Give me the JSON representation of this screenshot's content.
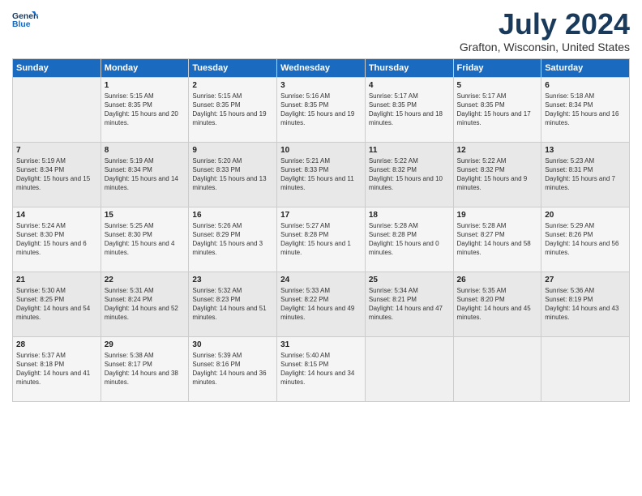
{
  "header": {
    "logo_line1": "General",
    "logo_line2": "Blue",
    "month": "July 2024",
    "location": "Grafton, Wisconsin, United States"
  },
  "weekdays": [
    "Sunday",
    "Monday",
    "Tuesday",
    "Wednesday",
    "Thursday",
    "Friday",
    "Saturday"
  ],
  "weeks": [
    [
      {
        "day": "",
        "sunrise": "",
        "sunset": "",
        "daylight": ""
      },
      {
        "day": "1",
        "sunrise": "Sunrise: 5:15 AM",
        "sunset": "Sunset: 8:35 PM",
        "daylight": "Daylight: 15 hours and 20 minutes."
      },
      {
        "day": "2",
        "sunrise": "Sunrise: 5:15 AM",
        "sunset": "Sunset: 8:35 PM",
        "daylight": "Daylight: 15 hours and 19 minutes."
      },
      {
        "day": "3",
        "sunrise": "Sunrise: 5:16 AM",
        "sunset": "Sunset: 8:35 PM",
        "daylight": "Daylight: 15 hours and 19 minutes."
      },
      {
        "day": "4",
        "sunrise": "Sunrise: 5:17 AM",
        "sunset": "Sunset: 8:35 PM",
        "daylight": "Daylight: 15 hours and 18 minutes."
      },
      {
        "day": "5",
        "sunrise": "Sunrise: 5:17 AM",
        "sunset": "Sunset: 8:35 PM",
        "daylight": "Daylight: 15 hours and 17 minutes."
      },
      {
        "day": "6",
        "sunrise": "Sunrise: 5:18 AM",
        "sunset": "Sunset: 8:34 PM",
        "daylight": "Daylight: 15 hours and 16 minutes."
      }
    ],
    [
      {
        "day": "7",
        "sunrise": "Sunrise: 5:19 AM",
        "sunset": "Sunset: 8:34 PM",
        "daylight": "Daylight: 15 hours and 15 minutes."
      },
      {
        "day": "8",
        "sunrise": "Sunrise: 5:19 AM",
        "sunset": "Sunset: 8:34 PM",
        "daylight": "Daylight: 15 hours and 14 minutes."
      },
      {
        "day": "9",
        "sunrise": "Sunrise: 5:20 AM",
        "sunset": "Sunset: 8:33 PM",
        "daylight": "Daylight: 15 hours and 13 minutes."
      },
      {
        "day": "10",
        "sunrise": "Sunrise: 5:21 AM",
        "sunset": "Sunset: 8:33 PM",
        "daylight": "Daylight: 15 hours and 11 minutes."
      },
      {
        "day": "11",
        "sunrise": "Sunrise: 5:22 AM",
        "sunset": "Sunset: 8:32 PM",
        "daylight": "Daylight: 15 hours and 10 minutes."
      },
      {
        "day": "12",
        "sunrise": "Sunrise: 5:22 AM",
        "sunset": "Sunset: 8:32 PM",
        "daylight": "Daylight: 15 hours and 9 minutes."
      },
      {
        "day": "13",
        "sunrise": "Sunrise: 5:23 AM",
        "sunset": "Sunset: 8:31 PM",
        "daylight": "Daylight: 15 hours and 7 minutes."
      }
    ],
    [
      {
        "day": "14",
        "sunrise": "Sunrise: 5:24 AM",
        "sunset": "Sunset: 8:30 PM",
        "daylight": "Daylight: 15 hours and 6 minutes."
      },
      {
        "day": "15",
        "sunrise": "Sunrise: 5:25 AM",
        "sunset": "Sunset: 8:30 PM",
        "daylight": "Daylight: 15 hours and 4 minutes."
      },
      {
        "day": "16",
        "sunrise": "Sunrise: 5:26 AM",
        "sunset": "Sunset: 8:29 PM",
        "daylight": "Daylight: 15 hours and 3 minutes."
      },
      {
        "day": "17",
        "sunrise": "Sunrise: 5:27 AM",
        "sunset": "Sunset: 8:28 PM",
        "daylight": "Daylight: 15 hours and 1 minute."
      },
      {
        "day": "18",
        "sunrise": "Sunrise: 5:28 AM",
        "sunset": "Sunset: 8:28 PM",
        "daylight": "Daylight: 15 hours and 0 minutes."
      },
      {
        "day": "19",
        "sunrise": "Sunrise: 5:28 AM",
        "sunset": "Sunset: 8:27 PM",
        "daylight": "Daylight: 14 hours and 58 minutes."
      },
      {
        "day": "20",
        "sunrise": "Sunrise: 5:29 AM",
        "sunset": "Sunset: 8:26 PM",
        "daylight": "Daylight: 14 hours and 56 minutes."
      }
    ],
    [
      {
        "day": "21",
        "sunrise": "Sunrise: 5:30 AM",
        "sunset": "Sunset: 8:25 PM",
        "daylight": "Daylight: 14 hours and 54 minutes."
      },
      {
        "day": "22",
        "sunrise": "Sunrise: 5:31 AM",
        "sunset": "Sunset: 8:24 PM",
        "daylight": "Daylight: 14 hours and 52 minutes."
      },
      {
        "day": "23",
        "sunrise": "Sunrise: 5:32 AM",
        "sunset": "Sunset: 8:23 PM",
        "daylight": "Daylight: 14 hours and 51 minutes."
      },
      {
        "day": "24",
        "sunrise": "Sunrise: 5:33 AM",
        "sunset": "Sunset: 8:22 PM",
        "daylight": "Daylight: 14 hours and 49 minutes."
      },
      {
        "day": "25",
        "sunrise": "Sunrise: 5:34 AM",
        "sunset": "Sunset: 8:21 PM",
        "daylight": "Daylight: 14 hours and 47 minutes."
      },
      {
        "day": "26",
        "sunrise": "Sunrise: 5:35 AM",
        "sunset": "Sunset: 8:20 PM",
        "daylight": "Daylight: 14 hours and 45 minutes."
      },
      {
        "day": "27",
        "sunrise": "Sunrise: 5:36 AM",
        "sunset": "Sunset: 8:19 PM",
        "daylight": "Daylight: 14 hours and 43 minutes."
      }
    ],
    [
      {
        "day": "28",
        "sunrise": "Sunrise: 5:37 AM",
        "sunset": "Sunset: 8:18 PM",
        "daylight": "Daylight: 14 hours and 41 minutes."
      },
      {
        "day": "29",
        "sunrise": "Sunrise: 5:38 AM",
        "sunset": "Sunset: 8:17 PM",
        "daylight": "Daylight: 14 hours and 38 minutes."
      },
      {
        "day": "30",
        "sunrise": "Sunrise: 5:39 AM",
        "sunset": "Sunset: 8:16 PM",
        "daylight": "Daylight: 14 hours and 36 minutes."
      },
      {
        "day": "31",
        "sunrise": "Sunrise: 5:40 AM",
        "sunset": "Sunset: 8:15 PM",
        "daylight": "Daylight: 14 hours and 34 minutes."
      },
      {
        "day": "",
        "sunrise": "",
        "sunset": "",
        "daylight": ""
      },
      {
        "day": "",
        "sunrise": "",
        "sunset": "",
        "daylight": ""
      },
      {
        "day": "",
        "sunrise": "",
        "sunset": "",
        "daylight": ""
      }
    ]
  ]
}
